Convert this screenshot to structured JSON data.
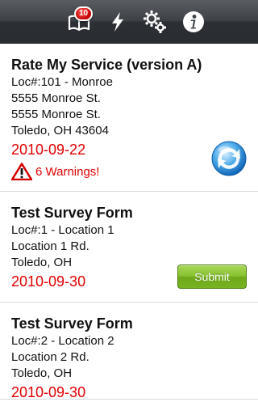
{
  "toolbar": {
    "inbox_badge": "10",
    "icons": [
      "book-icon",
      "lightning-icon",
      "gears-icon",
      "info-icon"
    ]
  },
  "cards": [
    {
      "title": "Rate My Service (version A)",
      "location": "Loc#:101 - Monroe",
      "address1": "5555 Monroe St.",
      "address2": "5555 Monroe St.",
      "city": "Toledo, OH 43604",
      "date": "2010-09-22",
      "warning": "6 Warnings!"
    },
    {
      "title": "Test Survey Form",
      "location": "Loc#:1 - Location 1",
      "address1": "Location 1 Rd.",
      "city": "Toledo, OH",
      "date": "2010-09-30",
      "submit_label": "Submit"
    },
    {
      "title": "Test Survey Form",
      "location": "Loc#:2 - Location 2",
      "address1": "Location 2 Rd.",
      "city": "Toledo, OH",
      "date": "2010-09-30"
    }
  ],
  "colors": {
    "date": "#e00000",
    "submit": "#86c12e",
    "toolbar": "#3d4146"
  }
}
